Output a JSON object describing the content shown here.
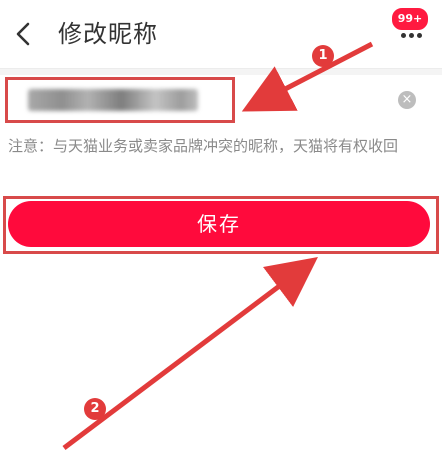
{
  "header": {
    "title": "修改昵称",
    "badge": "99+",
    "back_icon": "chevron-left-icon",
    "more_icon": "ellipsis-icon"
  },
  "input": {
    "clear_icon": "clear-circle-icon",
    "clear_glyph": "×"
  },
  "notice": "注意：与天猫业务或卖家品牌冲突的昵称，天猫将有权收回",
  "save_label": "保存",
  "annotations": {
    "step1": "1",
    "step2": "2",
    "color": "#e23b3b"
  },
  "colors": {
    "primary": "#ff0a3c",
    "badge": "#ff1a40",
    "highlight": "#d84a4a"
  }
}
